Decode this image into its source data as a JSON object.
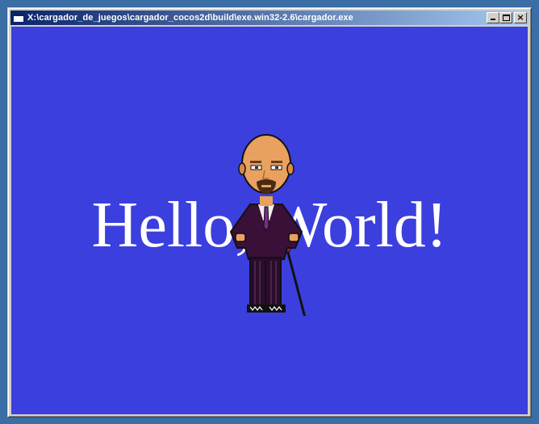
{
  "window": {
    "title": "X:\\cargador_de_juegos\\cargador_cocos2d\\build\\exe.win32-2.6\\cargador.exe",
    "icon": "app-window-icon",
    "buttons": {
      "minimize_icon": "minimize-icon",
      "maximize_icon": "maximize-icon",
      "close_icon": "close-icon",
      "close_glyph": "×"
    }
  },
  "scene": {
    "background_color": "#3b3fdd",
    "label_text": "Hello, World!",
    "label_color": "#ffffff",
    "sprite": "bald-man-in-suit-with-cane"
  }
}
